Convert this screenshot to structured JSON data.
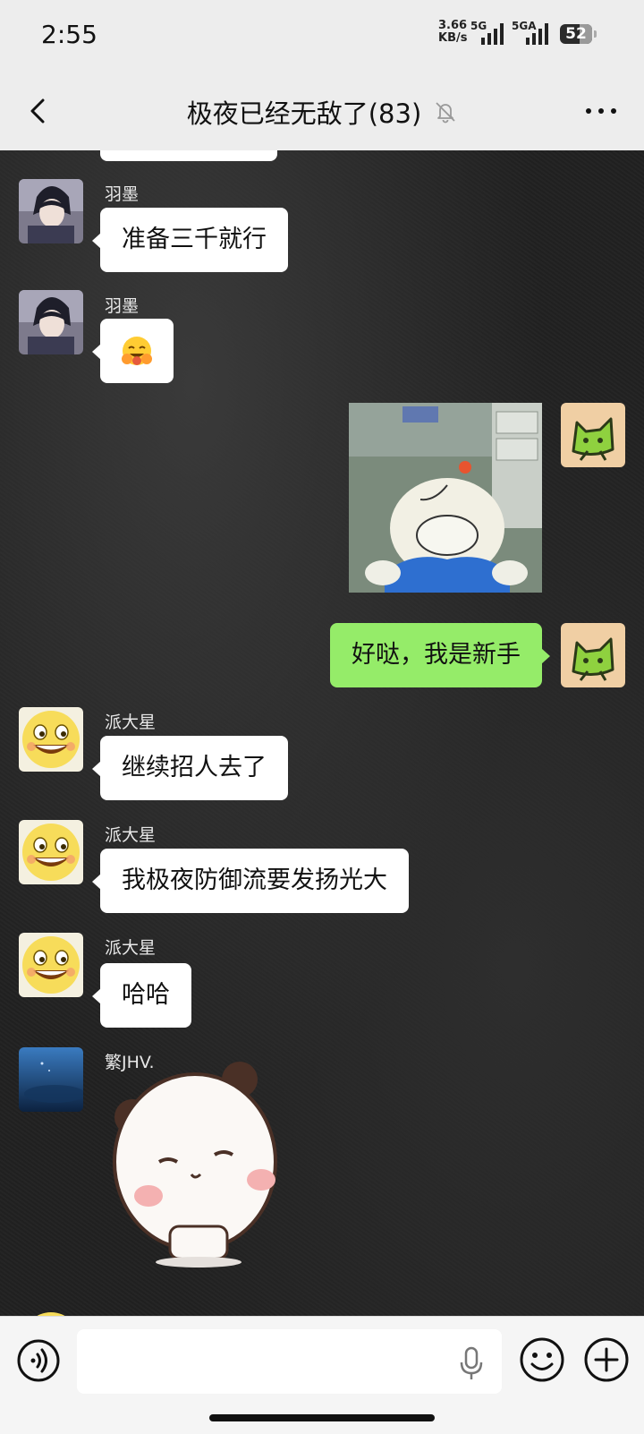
{
  "status": {
    "time": "2:55",
    "net_speed_value": "3.66",
    "net_speed_unit": "KB/s",
    "sim1_label": "5G",
    "sim2_label": "5GA",
    "battery": "52"
  },
  "header": {
    "title": "极夜已经无敌了(83)",
    "back_icon": "chevron-left-icon",
    "mute_icon": "bell-muted-icon",
    "more_icon": "more-horizontal-icon"
  },
  "messages": [
    {
      "sender": "羽墨",
      "text": "准备三千就行",
      "side": "left",
      "avatar": "anime-boy-avatar"
    },
    {
      "sender": "羽墨",
      "text": "",
      "side": "left",
      "emoji": "grinning-face-hands-emoji"
    },
    {
      "side": "right",
      "sticker": "doraemon-sticker",
      "avatar": "green-cat-avatar"
    },
    {
      "side": "right",
      "text": "好哒，我是新手",
      "avatar": "green-cat-avatar"
    },
    {
      "sender": "派大星",
      "text": "继续招人去了",
      "side": "left",
      "avatar": "smiley-avatar"
    },
    {
      "sender": "派大星",
      "text": "我极夜防御流要发扬光大",
      "side": "left",
      "avatar": "smiley-avatar"
    },
    {
      "sender": "派大星",
      "text": "哈哈",
      "side": "left",
      "avatar": "smiley-avatar"
    },
    {
      "sender": "繁JHV.",
      "side": "left",
      "sticker": "panda-bear-sticker",
      "avatar": "ocean-avatar"
    }
  ],
  "input": {
    "voice_icon": "voice-icon",
    "mic_icon": "microphone-icon",
    "emoji_icon": "emoji-icon",
    "plus_icon": "plus-icon",
    "value": ""
  }
}
